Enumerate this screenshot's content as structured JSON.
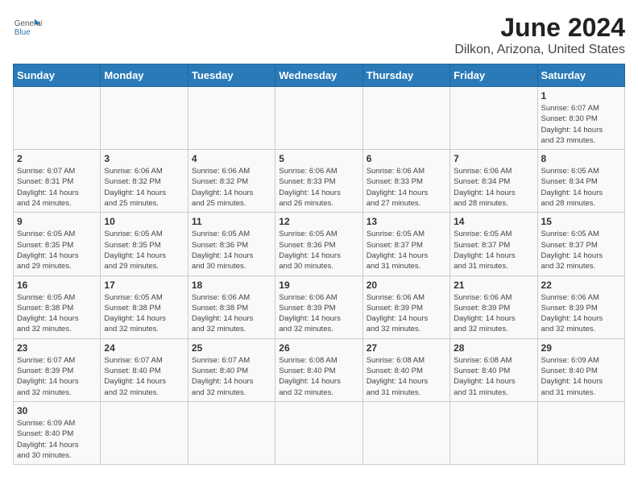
{
  "header": {
    "logo_general": "General",
    "logo_blue": "Blue",
    "title": "June 2024",
    "subtitle": "Dilkon, Arizona, United States"
  },
  "weekdays": [
    "Sunday",
    "Monday",
    "Tuesday",
    "Wednesday",
    "Thursday",
    "Friday",
    "Saturday"
  ],
  "weeks": [
    [
      {
        "day": "",
        "info": ""
      },
      {
        "day": "",
        "info": ""
      },
      {
        "day": "",
        "info": ""
      },
      {
        "day": "",
        "info": ""
      },
      {
        "day": "",
        "info": ""
      },
      {
        "day": "",
        "info": ""
      },
      {
        "day": "1",
        "info": "Sunrise: 6:07 AM\nSunset: 8:30 PM\nDaylight: 14 hours\nand 23 minutes."
      }
    ],
    [
      {
        "day": "2",
        "info": "Sunrise: 6:07 AM\nSunset: 8:31 PM\nDaylight: 14 hours\nand 24 minutes."
      },
      {
        "day": "3",
        "info": "Sunrise: 6:06 AM\nSunset: 8:32 PM\nDaylight: 14 hours\nand 25 minutes."
      },
      {
        "day": "4",
        "info": "Sunrise: 6:06 AM\nSunset: 8:32 PM\nDaylight: 14 hours\nand 25 minutes."
      },
      {
        "day": "5",
        "info": "Sunrise: 6:06 AM\nSunset: 8:33 PM\nDaylight: 14 hours\nand 26 minutes."
      },
      {
        "day": "6",
        "info": "Sunrise: 6:06 AM\nSunset: 8:33 PM\nDaylight: 14 hours\nand 27 minutes."
      },
      {
        "day": "7",
        "info": "Sunrise: 6:06 AM\nSunset: 8:34 PM\nDaylight: 14 hours\nand 28 minutes."
      },
      {
        "day": "8",
        "info": "Sunrise: 6:05 AM\nSunset: 8:34 PM\nDaylight: 14 hours\nand 28 minutes."
      }
    ],
    [
      {
        "day": "9",
        "info": "Sunrise: 6:05 AM\nSunset: 8:35 PM\nDaylight: 14 hours\nand 29 minutes."
      },
      {
        "day": "10",
        "info": "Sunrise: 6:05 AM\nSunset: 8:35 PM\nDaylight: 14 hours\nand 29 minutes."
      },
      {
        "day": "11",
        "info": "Sunrise: 6:05 AM\nSunset: 8:36 PM\nDaylight: 14 hours\nand 30 minutes."
      },
      {
        "day": "12",
        "info": "Sunrise: 6:05 AM\nSunset: 8:36 PM\nDaylight: 14 hours\nand 30 minutes."
      },
      {
        "day": "13",
        "info": "Sunrise: 6:05 AM\nSunset: 8:37 PM\nDaylight: 14 hours\nand 31 minutes."
      },
      {
        "day": "14",
        "info": "Sunrise: 6:05 AM\nSunset: 8:37 PM\nDaylight: 14 hours\nand 31 minutes."
      },
      {
        "day": "15",
        "info": "Sunrise: 6:05 AM\nSunset: 8:37 PM\nDaylight: 14 hours\nand 32 minutes."
      }
    ],
    [
      {
        "day": "16",
        "info": "Sunrise: 6:05 AM\nSunset: 8:38 PM\nDaylight: 14 hours\nand 32 minutes."
      },
      {
        "day": "17",
        "info": "Sunrise: 6:05 AM\nSunset: 8:38 PM\nDaylight: 14 hours\nand 32 minutes."
      },
      {
        "day": "18",
        "info": "Sunrise: 6:06 AM\nSunset: 8:38 PM\nDaylight: 14 hours\nand 32 minutes."
      },
      {
        "day": "19",
        "info": "Sunrise: 6:06 AM\nSunset: 8:39 PM\nDaylight: 14 hours\nand 32 minutes."
      },
      {
        "day": "20",
        "info": "Sunrise: 6:06 AM\nSunset: 8:39 PM\nDaylight: 14 hours\nand 32 minutes."
      },
      {
        "day": "21",
        "info": "Sunrise: 6:06 AM\nSunset: 8:39 PM\nDaylight: 14 hours\nand 32 minutes."
      },
      {
        "day": "22",
        "info": "Sunrise: 6:06 AM\nSunset: 8:39 PM\nDaylight: 14 hours\nand 32 minutes."
      }
    ],
    [
      {
        "day": "23",
        "info": "Sunrise: 6:07 AM\nSunset: 8:39 PM\nDaylight: 14 hours\nand 32 minutes."
      },
      {
        "day": "24",
        "info": "Sunrise: 6:07 AM\nSunset: 8:40 PM\nDaylight: 14 hours\nand 32 minutes."
      },
      {
        "day": "25",
        "info": "Sunrise: 6:07 AM\nSunset: 8:40 PM\nDaylight: 14 hours\nand 32 minutes."
      },
      {
        "day": "26",
        "info": "Sunrise: 6:08 AM\nSunset: 8:40 PM\nDaylight: 14 hours\nand 32 minutes."
      },
      {
        "day": "27",
        "info": "Sunrise: 6:08 AM\nSunset: 8:40 PM\nDaylight: 14 hours\nand 31 minutes."
      },
      {
        "day": "28",
        "info": "Sunrise: 6:08 AM\nSunset: 8:40 PM\nDaylight: 14 hours\nand 31 minutes."
      },
      {
        "day": "29",
        "info": "Sunrise: 6:09 AM\nSunset: 8:40 PM\nDaylight: 14 hours\nand 31 minutes."
      }
    ],
    [
      {
        "day": "30",
        "info": "Sunrise: 6:09 AM\nSunset: 8:40 PM\nDaylight: 14 hours\nand 30 minutes."
      },
      {
        "day": "",
        "info": ""
      },
      {
        "day": "",
        "info": ""
      },
      {
        "day": "",
        "info": ""
      },
      {
        "day": "",
        "info": ""
      },
      {
        "day": "",
        "info": ""
      },
      {
        "day": "",
        "info": ""
      }
    ]
  ]
}
